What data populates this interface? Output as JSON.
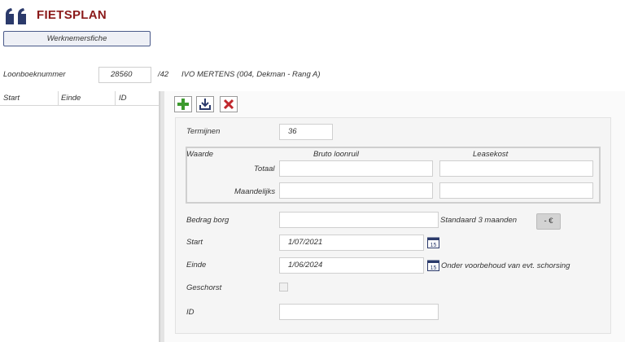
{
  "app": {
    "title": "FIETSPLAN"
  },
  "tabs": [
    {
      "label": "Werknemersfiche"
    }
  ],
  "employee": {
    "label": "Loonboeknummer",
    "number": "28560",
    "suffix": "/42",
    "name": "IVO MERTENS (004, Dekman - Rang A)"
  },
  "list": {
    "columns": [
      "Start",
      "Einde",
      "ID"
    ]
  },
  "toolbar": {
    "add_icon": "plus-icon",
    "download_icon": "download-icon",
    "delete_icon": "close-icon"
  },
  "form": {
    "termijnen_label": "Termijnen",
    "termijnen_value": "36",
    "waarde": {
      "label": "Waarde",
      "col1": "Bruto loonruil",
      "col2": "Leasekost",
      "row1": "Totaal",
      "row2": "Maandelijks"
    },
    "borg_label": "Bedrag borg",
    "borg_value": "",
    "borg_hint": "Standaard 3 maanden",
    "borg_button": "- €",
    "start_label": "Start",
    "start_value": "1/07/2021",
    "einde_label": "Einde",
    "einde_value": "1/06/2024",
    "einde_note": "Onder voorbehoud van evt. schorsing",
    "geschorst_label": "Geschorst",
    "geschorst_checked": false,
    "id_label": "ID",
    "id_value": "",
    "calendar_day": "15"
  },
  "colors": {
    "brand": "#8b1a1a",
    "logo": "#2b3a6b",
    "add": "#3c9a2e",
    "delete": "#c0282d"
  }
}
